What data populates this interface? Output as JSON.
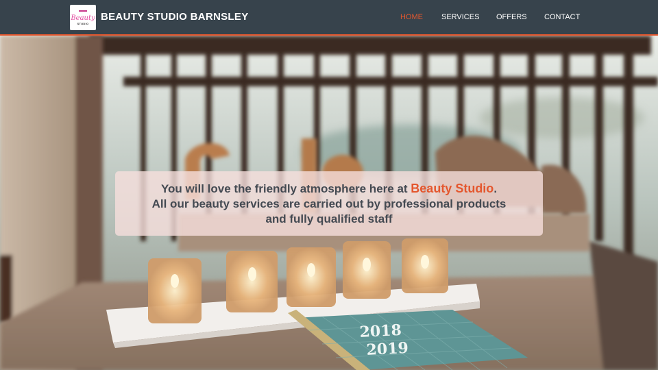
{
  "header": {
    "logo": {
      "script_text": "Beauty",
      "sub_text": "STUDIO"
    },
    "brand": "BEAUTY STUDIO BARNSLEY",
    "nav": [
      {
        "label": "HOME",
        "active": true
      },
      {
        "label": "SERVICES",
        "active": false
      },
      {
        "label": "OFFERS",
        "active": false
      },
      {
        "label": "CONTACT",
        "active": false
      }
    ]
  },
  "hero": {
    "line1_prefix": "You will love the friendly atmosphere here at ",
    "highlight": "Beauty Studio",
    "line1_suffix": ".",
    "line2": "All our beauty services are carried out by professional products",
    "line3": "and fully qualified staff",
    "planner_text": [
      "2018",
      "2019"
    ]
  },
  "colors": {
    "navbar_bg": "#37434c",
    "accent": "#e4572e",
    "overlay_bg": "#f6dedc",
    "text_dark": "#444a52"
  }
}
